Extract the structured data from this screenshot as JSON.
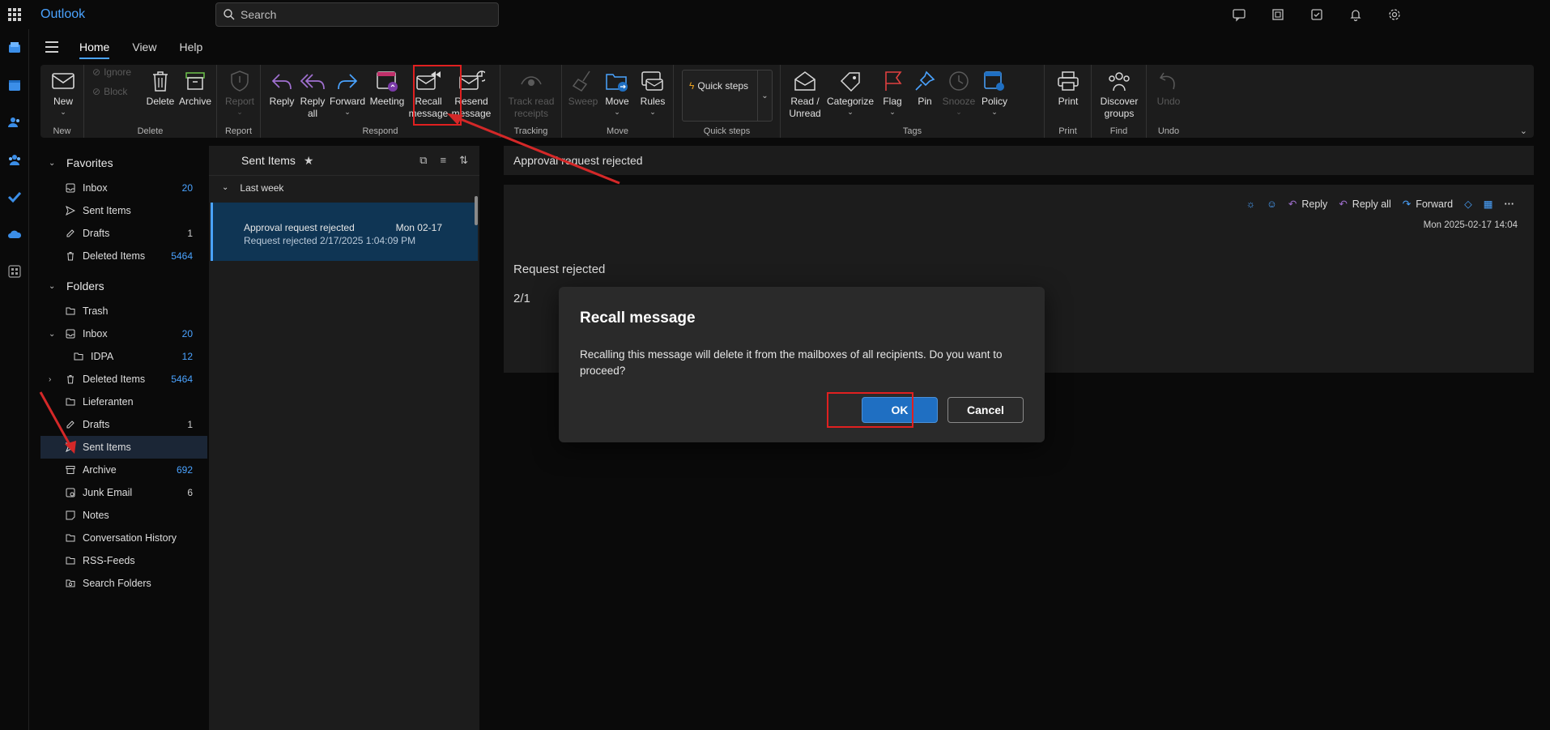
{
  "app": {
    "title": "Outlook"
  },
  "search": {
    "placeholder": "Search"
  },
  "tabs": [
    {
      "label": "Home"
    },
    {
      "label": "View"
    },
    {
      "label": "Help"
    }
  ],
  "ribbon": {
    "groups": {
      "new": "New",
      "delete": "Delete",
      "report": "Report",
      "respond": "Respond",
      "tracking": "Tracking",
      "move": "Move",
      "quick_steps": "Quick steps",
      "tags": "Tags",
      "print": "Print",
      "find": "Find",
      "undo": "Undo"
    },
    "buttons": {
      "new": "New",
      "ignore": "Ignore",
      "block": "Block",
      "delete": "Delete",
      "archive": "Archive",
      "report_l1": "Report",
      "report_l2": "",
      "reply": "Reply",
      "reply_all_l1": "Reply",
      "reply_all_l2": "all",
      "forward": "Forward",
      "meeting": "Meeting",
      "recall_l1": "Recall",
      "recall_l2": "message",
      "resend_l1": "Resend",
      "resend_l2": "message",
      "track_l1": "Track read",
      "track_l2": "receipts",
      "sweep": "Sweep",
      "move": "Move",
      "rules": "Rules",
      "quick_steps": "Quick steps",
      "read_l1": "Read /",
      "read_l2": "Unread",
      "categorize": "Categorize",
      "flag": "Flag",
      "pin": "Pin",
      "snooze": "Snooze",
      "policy": "Policy",
      "print": "Print",
      "discover_l1": "Discover",
      "discover_l2": "groups",
      "undo": "Undo"
    }
  },
  "nav": {
    "favorites_label": "Favorites",
    "favorites": [
      {
        "label": "Inbox",
        "count": "20"
      },
      {
        "label": "Sent Items",
        "count": ""
      },
      {
        "label": "Drafts",
        "count": "1"
      },
      {
        "label": "Deleted Items",
        "count": "5464"
      }
    ],
    "folders_label": "Folders",
    "folders": [
      {
        "label": "Trash",
        "count": ""
      },
      {
        "label": "Inbox",
        "count": "20"
      },
      {
        "label": "IDPA",
        "count": "12"
      },
      {
        "label": "Deleted Items",
        "count": "5464"
      },
      {
        "label": "Lieferanten",
        "count": ""
      },
      {
        "label": "Drafts",
        "count": "1"
      },
      {
        "label": "Sent Items",
        "count": ""
      },
      {
        "label": "Archive",
        "count": "692"
      },
      {
        "label": "Junk Email",
        "count": "6"
      },
      {
        "label": "Notes",
        "count": ""
      },
      {
        "label": "Conversation History",
        "count": ""
      },
      {
        "label": "RSS-Feeds",
        "count": ""
      },
      {
        "label": "Search Folders",
        "count": ""
      }
    ]
  },
  "message_list": {
    "title": "Sent Items",
    "group": "Last week",
    "item": {
      "subject": "Approval request rejected",
      "date": "Mon 02-17",
      "preview": "Request rejected 2/17/2025 1:04:09 PM"
    }
  },
  "reading": {
    "title": "Approval request rejected",
    "reply": "Reply",
    "reply_all": "Reply all",
    "forward": "Forward",
    "date": "Mon 2025-02-17 14:04",
    "body1": "Request rejected",
    "body2": "2/1"
  },
  "dialog": {
    "title": "Recall message",
    "text": "Recalling this message will delete it from the mailboxes of all recipients. Do you want to proceed?",
    "ok": "OK",
    "cancel": "Cancel"
  },
  "colors": {
    "accent": "#4aa3ff",
    "annotation": "#e02020",
    "ok_button": "#1f6fc2"
  }
}
